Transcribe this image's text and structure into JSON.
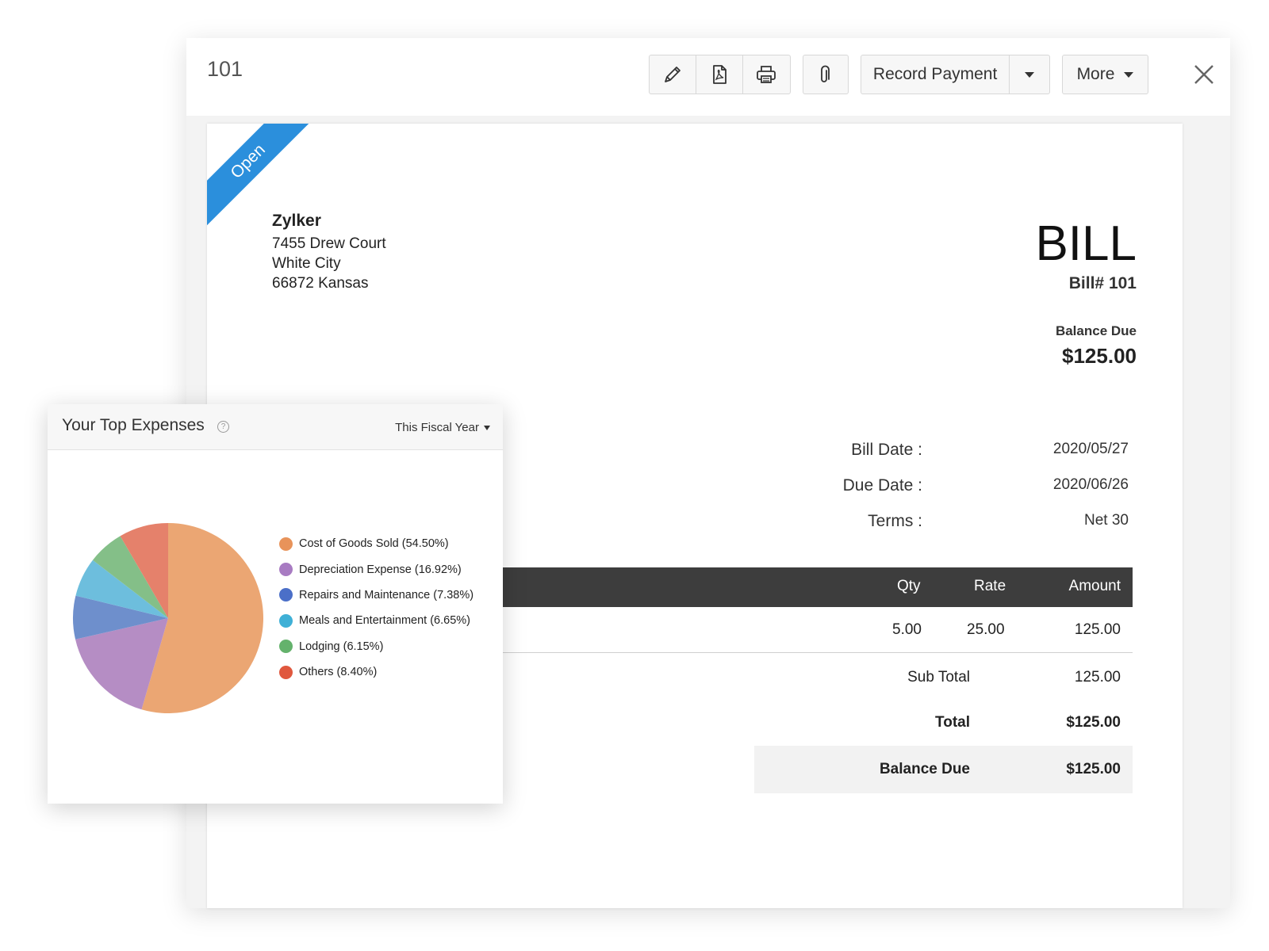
{
  "window": {
    "title": "101",
    "toolbar": {
      "edit_icon": "pencil-icon",
      "pdf_icon": "pdf-icon",
      "print_icon": "printer-icon",
      "attach_icon": "paperclip-icon",
      "record_payment_label": "Record Payment",
      "more_label": "More",
      "close_icon": "close-icon"
    }
  },
  "bill": {
    "status": "Open",
    "vendor": {
      "name": "Zylker",
      "address_line1": "7455 Drew Court",
      "address_line2": "White City",
      "address_line3": "66872 Kansas"
    },
    "heading": "BILL",
    "bill_number": "Bill# 101",
    "balance_due_label": "Balance Due",
    "balance_due_amount": "$125.00",
    "meta": [
      {
        "label": "Bill Date :",
        "value": "2020/05/27"
      },
      {
        "label": "Due Date :",
        "value": "2020/06/26"
      },
      {
        "label": "Terms :",
        "value": "Net 30"
      }
    ],
    "table": {
      "headers": {
        "qty": "Qty",
        "rate": "Rate",
        "amount": "Amount"
      },
      "rows": [
        {
          "qty": "5.00",
          "rate": "25.00",
          "amount": "125.00"
        }
      ]
    },
    "totals": {
      "sub_total_label": "Sub Total",
      "sub_total_value": "125.00",
      "total_label": "Total",
      "total_value": "$125.00",
      "balance_due_label": "Balance Due",
      "balance_due_value": "$125.00"
    }
  },
  "expenses_widget": {
    "title": "Your Top Expenses",
    "help_icon": "help-circle-icon",
    "period": "This Fiscal Year"
  },
  "chart_data": {
    "type": "pie",
    "title": "Your Top Expenses",
    "legend_position": "right",
    "categories": [
      "Cost of Goods Sold (54.50%)",
      "Depreciation Expense (16.92%)",
      "Repairs and Maintenance (7.38%)",
      "Meals and Entertainment (6.65%)",
      "Lodging (6.15%)",
      "Others (8.40%)"
    ],
    "values": [
      54.5,
      16.92,
      7.38,
      6.65,
      6.15,
      8.4
    ],
    "colors": [
      "#eba673",
      "#b58dc4",
      "#6e8fcc",
      "#6dbedd",
      "#84bf88",
      "#e5816b"
    ],
    "legend_colors": [
      "#e8935a",
      "#a87bc2",
      "#4b6fc8",
      "#3fb0d6",
      "#64b26c",
      "#e0583e"
    ]
  }
}
